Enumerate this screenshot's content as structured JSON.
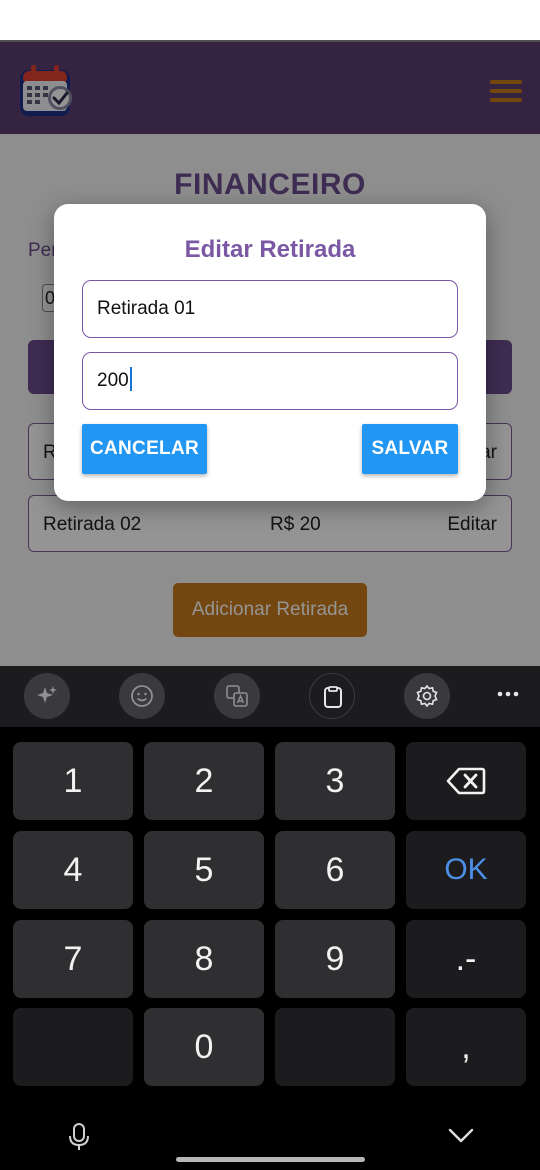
{
  "header": {
    "logo_icon": "calendar-check-icon",
    "menu_icon": "hamburger-menu-icon",
    "bar_color": "#5a3f73",
    "accent_color": "#c77a1a"
  },
  "page": {
    "title": "FINANCEIRO",
    "period_label": "Per",
    "date_value": "0",
    "add_button_label": "Adicionar Retirada",
    "rows": [
      {
        "name": "R",
        "value": "",
        "edit_label": "ar"
      },
      {
        "name": "Retirada 02",
        "value": "R$ 20",
        "edit_label": "Editar"
      }
    ]
  },
  "dialog": {
    "title": "Editar Retirada",
    "name_value": "Retirada 01",
    "amount_value": "200",
    "cancel_label": "CANCELAR",
    "save_label": "SALVAR",
    "title_color": "#7b58a3",
    "button_color": "#2196f3"
  },
  "keyboard": {
    "toolbar_icons": [
      "sparkle-icon",
      "emoji-icon",
      "translate-icon",
      "clipboard-icon",
      "settings-icon",
      "more-icon"
    ],
    "keys": {
      "k1": "1",
      "k2": "2",
      "k3": "3",
      "k4": "4",
      "k5": "5",
      "k6": "6",
      "k7": "7",
      "k8": "8",
      "k9": "9",
      "k0": "0",
      "ok": "OK",
      "dot_dash": ".-",
      "comma": ","
    },
    "ok_color": "#4d8fe6"
  }
}
